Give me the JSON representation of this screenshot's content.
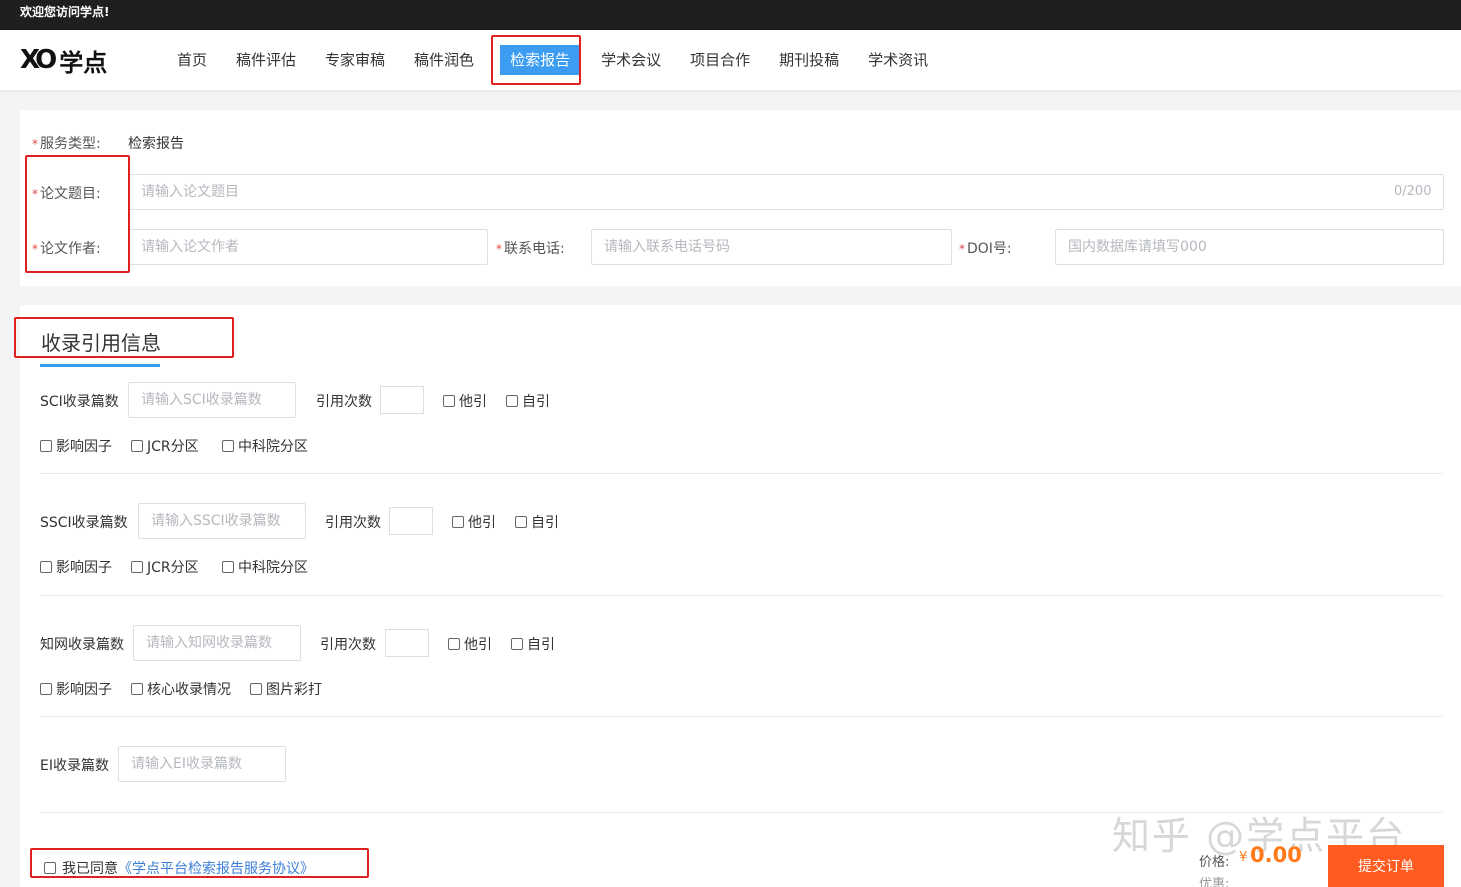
{
  "topbar": {
    "welcome": "欢迎您访问学点!"
  },
  "brand": {
    "mark": "XO",
    "name": "学点"
  },
  "nav": {
    "items": [
      {
        "label": "首页"
      },
      {
        "label": "稿件评估"
      },
      {
        "label": "专家审稿"
      },
      {
        "label": "稿件润色"
      },
      {
        "label": "检索报告",
        "active": true
      },
      {
        "label": "学术会议"
      },
      {
        "label": "项目合作"
      },
      {
        "label": "期刊投稿"
      },
      {
        "label": "学术资讯"
      }
    ]
  },
  "form": {
    "required_mark": "*",
    "service_type_label": "服务类型:",
    "service_type_value": "检索报告",
    "title_label": "论文题目:",
    "title_placeholder": "请输入论文题目",
    "title_counter": "0/200",
    "author_label": "论文作者:",
    "author_placeholder": "请输入论文作者",
    "phone_label": "联系电话:",
    "phone_placeholder": "请输入联系电话号码",
    "doi_label": "DOI号:",
    "doi_placeholder": "国内数据库请填写000"
  },
  "citation": {
    "section_title": "收录引用信息",
    "cite_count_label": "引用次数",
    "other_cite": "他引",
    "self_cite": "自引",
    "impact_factor": "影响因子",
    "jcr": "JCR分区",
    "cas": "中科院分区",
    "core_status": "核心收录情况",
    "image_color": "图片彩打",
    "sci": {
      "label": "SCI收录篇数",
      "placeholder": "请输入SCI收录篇数"
    },
    "ssci": {
      "label": "SSCI收录篇数",
      "placeholder": "请输入SSCI收录篇数"
    },
    "cnki": {
      "label": "知网收录篇数",
      "placeholder": "请输入知网收录篇数"
    },
    "ei": {
      "label": "EI收录篇数",
      "placeholder": "请输入EI收录篇数"
    }
  },
  "footer": {
    "agree_text": "我已同意",
    "agreement_link": "《学点平台检索报告服务协议》",
    "price_label": "价格:",
    "currency": "¥",
    "price_value": "0.00",
    "discount_label": "优惠:",
    "submit_label": "提交订单"
  },
  "watermark": "知乎 @学点平台",
  "colors": {
    "accent": "#3b9cf1",
    "highlight_box": "#e02020",
    "price": "#ff7a1a",
    "submit": "#ff5a1f",
    "topbar": "#1f1f1f"
  }
}
